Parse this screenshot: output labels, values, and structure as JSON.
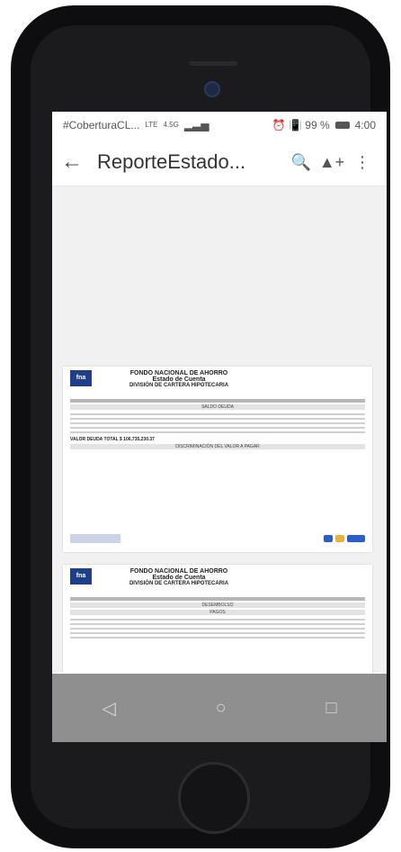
{
  "status_bar": {
    "left": "#CoberturaCL...",
    "network": "LTE",
    "signal": "4.5G",
    "right": "⏰ 📳 99 %",
    "time": "4:00"
  },
  "app_bar": {
    "title": "ReporteEstado...",
    "icons": [
      "arrow-back-icon",
      "search-doc-icon",
      "add-to-drive-icon",
      "more-vert-icon"
    ]
  },
  "doc": {
    "logo": "fna",
    "org": "FONDO NACIONAL DE AHORRO",
    "statement": "Estado de Cuenta",
    "division": "DIVISIÓN DE CARTERA HIPOTECARIA",
    "sections": [
      "SALDO DEUDA",
      "DISCRIMINACIÓN DEL VALOR A PAGAR",
      "DESEMBOLSO",
      "PAGOS"
    ],
    "total_label": "VALOR DEUDA TOTAL",
    "total_value": "$ 106,735,230.37"
  },
  "nav": {
    "back": "◁",
    "home": "○",
    "recent": "□"
  }
}
